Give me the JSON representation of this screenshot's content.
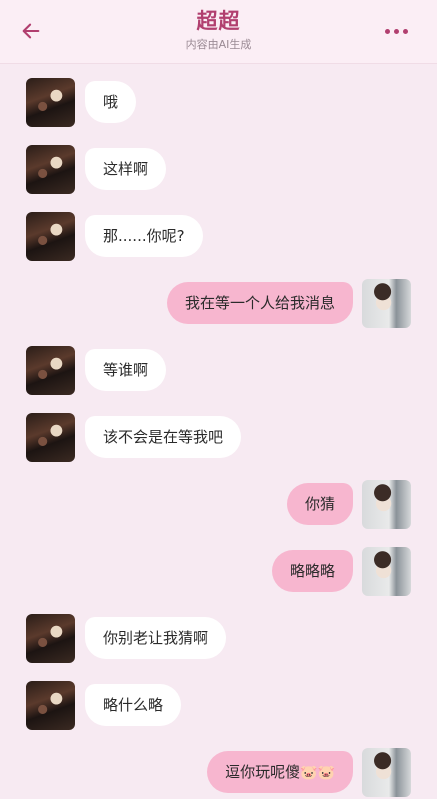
{
  "header": {
    "title": "超超",
    "subtitle": "内容由AI生成",
    "back_icon": "arrow-left-icon",
    "more_icon": "more-horizontal-icon",
    "accent_color": "#b13f6f"
  },
  "messages": [
    {
      "side": "in",
      "text": "哦"
    },
    {
      "side": "in",
      "text": "这样啊"
    },
    {
      "side": "in",
      "text": "那......你呢?"
    },
    {
      "side": "out",
      "text": "我在等一个人给我消息"
    },
    {
      "side": "in",
      "text": "等谁啊"
    },
    {
      "side": "in",
      "text": "该不会是在等我吧"
    },
    {
      "side": "out",
      "text": "你猜"
    },
    {
      "side": "out",
      "text": "略略略"
    },
    {
      "side": "in",
      "text": "你别老让我猜啊"
    },
    {
      "side": "in",
      "text": "略什么略"
    },
    {
      "side": "out",
      "text": "逗你玩呢傻",
      "emoji": "🐷🐷"
    }
  ],
  "colors": {
    "background": "#f7eaf2",
    "incoming_bubble": "#ffffff",
    "outgoing_bubble": "#f7b6cf"
  }
}
